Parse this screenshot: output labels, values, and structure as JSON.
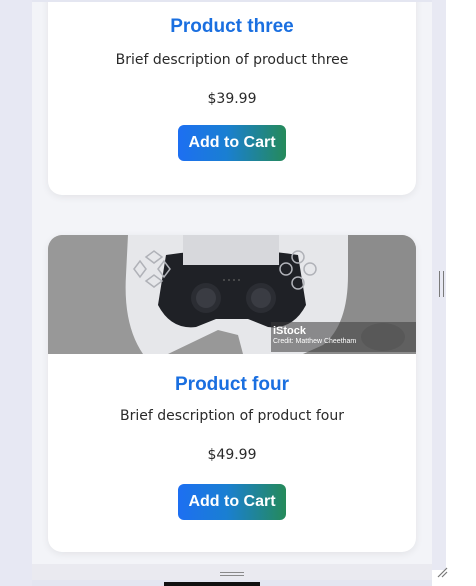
{
  "products": [
    {
      "name": "Product three",
      "description": "Brief description of product three",
      "price": "$39.99",
      "button_label": "Add to Cart"
    },
    {
      "name": "Product four",
      "description": "Brief description of product four",
      "price": "$49.99",
      "button_label": "Add to Cart",
      "image": {
        "subject": "game-controller",
        "watermark_brand": "iStock",
        "watermark_credit": "Credit: Matthew Cheetham"
      }
    }
  ],
  "colors": {
    "title": "#1a6fe0",
    "button_gradient_start": "#1d6ff2",
    "button_gradient_end": "#258a5a",
    "page_background": "#f3f4f8"
  }
}
